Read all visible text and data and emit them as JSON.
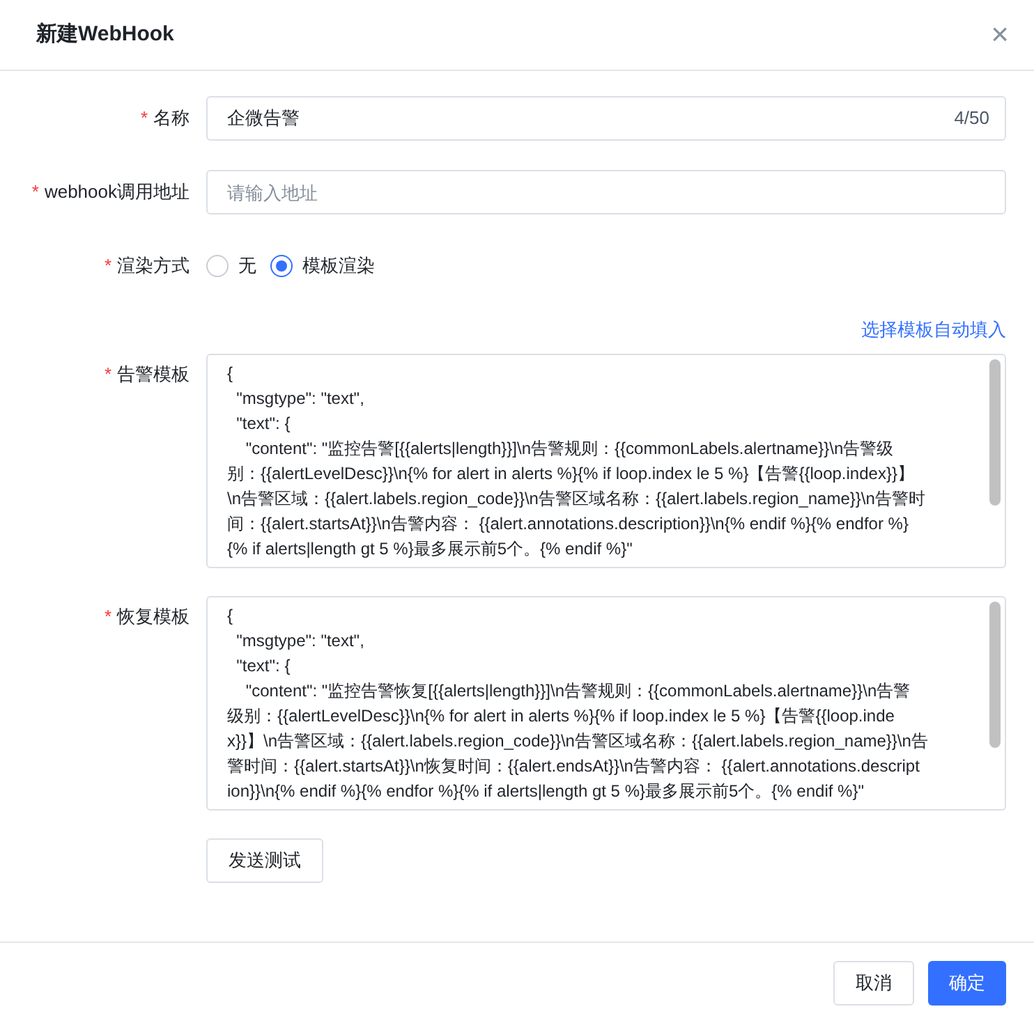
{
  "dialog": {
    "title": "新建WebHook",
    "close": "×"
  },
  "fields": [
    {
      "kind": "text",
      "label": "名称",
      "required_mark": "*",
      "value": "企微告警",
      "counter": "4/50"
    },
    {
      "kind": "text",
      "label": "webhook调用地址",
      "required_mark": "*",
      "placeholder": "请输入地址"
    },
    {
      "kind": "radio",
      "label": "渲染方式",
      "required_mark": "*",
      "options": [
        {
          "label": "无",
          "selected": false
        },
        {
          "label": "模板渲染",
          "selected": true
        }
      ]
    },
    {
      "kind": "link",
      "text": "选择模板自动填入"
    },
    {
      "kind": "textarea",
      "label": "告警模板",
      "required_mark": "*",
      "lines": [
        "{",
        "  \"msgtype\": \"text\",",
        "  \"text\": {",
        "    \"content\": \"监控告警[{{alerts|length}}]\\n告警规则：{{commonLabels.alertname}}\\n告警级",
        "别：{{alertLevelDesc}}\\n{% for alert in alerts %}{% if loop.index le 5 %}【告警{{loop.index}}】",
        "\\n告警区域：{{alert.labels.region_code}}\\n告警区域名称：{{alert.labels.region_name}}\\n告警时",
        "间：{{alert.startsAt}}\\n告警内容： {{alert.annotations.description}}\\n{% endif %}{% endfor %}",
        "{% if alerts|length gt 5 %}最多展示前5个。{% endif %}\""
      ]
    },
    {
      "kind": "textarea",
      "label": "恢复模板",
      "required_mark": "*",
      "lines": [
        "{",
        "  \"msgtype\": \"text\",",
        "  \"text\": {",
        "    \"content\": \"监控告警恢复[{{alerts|length}}]\\n告警规则：{{commonLabels.alertname}}\\n告警",
        "级别：{{alertLevelDesc}}\\n{% for alert in alerts %}{% if loop.index le 5 %}【告警{{loop.inde",
        "x}}】\\n告警区域：{{alert.labels.region_code}}\\n告警区域名称：{{alert.labels.region_name}}\\n告",
        "警时间：{{alert.startsAt}}\\n恢复时间：{{alert.endsAt}}\\n告警内容： {{alert.annotations.descript",
        "ion}}\\n{% endif %}{% endfor %}{% if alerts|length gt 5 %}最多展示前5个。{% endif %}\""
      ]
    },
    {
      "kind": "button",
      "text": "发送测试"
    }
  ],
  "footer": {
    "buttons": [
      {
        "text": "取消",
        "kind": "default"
      },
      {
        "text": "确定",
        "kind": "primary"
      }
    ]
  }
}
